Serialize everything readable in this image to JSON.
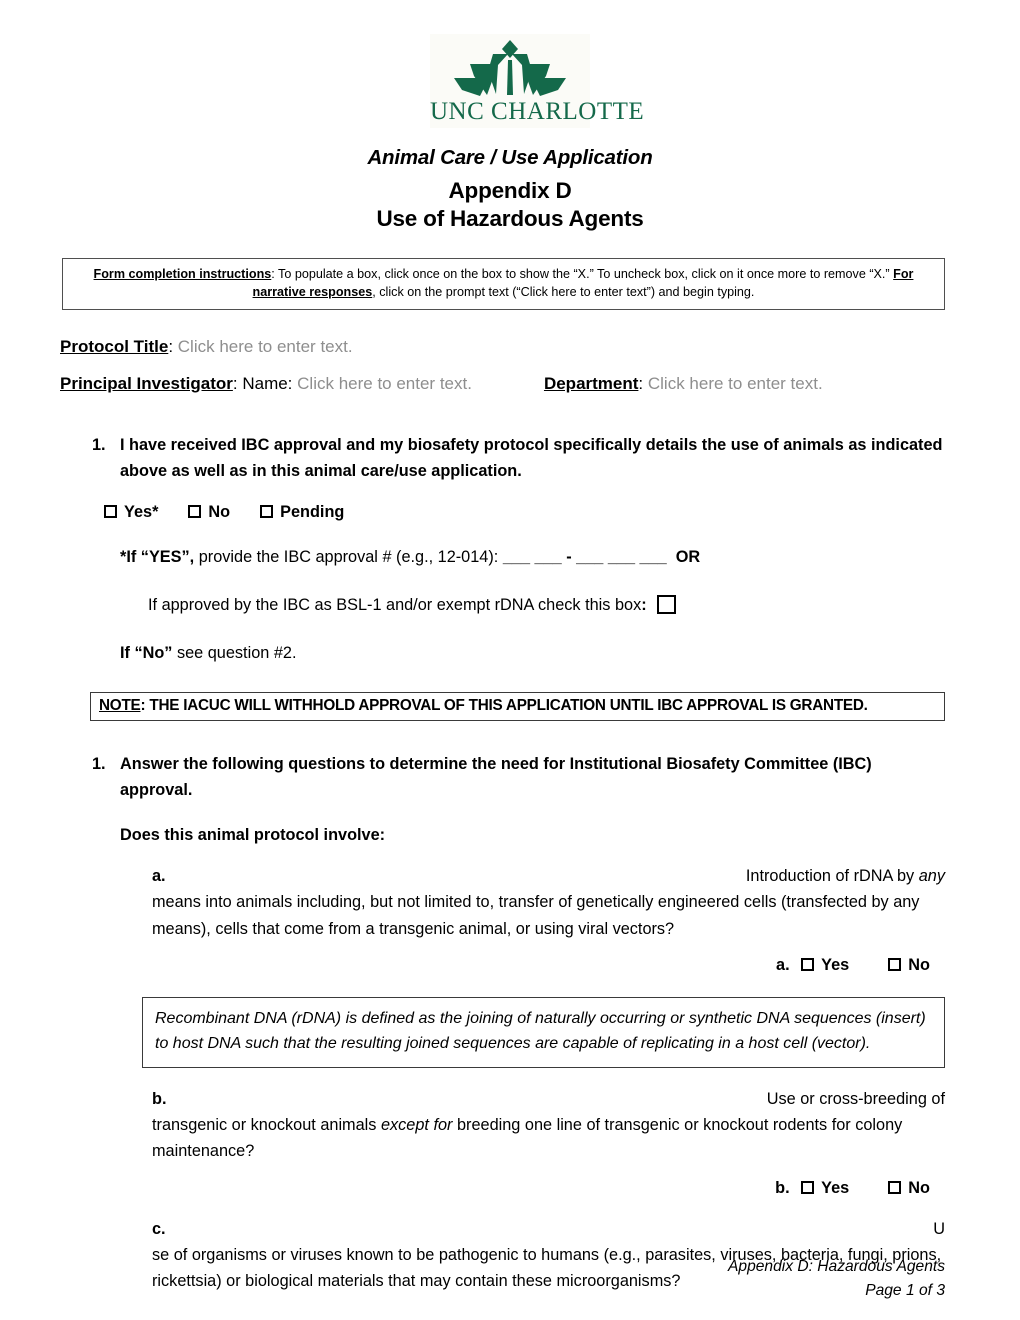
{
  "logo": {
    "institution": "UNC CHARLOTTE",
    "mark": "crown-icon",
    "brand_green": "#14694a"
  },
  "header": {
    "subtitle": "Animal Care / Use Application",
    "title_line1": "Appendix D",
    "title_line2": "Use of Hazardous Agents"
  },
  "instructions": {
    "label": "Form completion instructions",
    "text_part1": ": To populate a box, click once on the box to show the “X.”  To uncheck box, click on it once more to remove “X.” ",
    "label2": "For narrative responses",
    "text_part2": ", click on the prompt text (“Click here to enter text”) and begin typing."
  },
  "fields": {
    "protocol_title_label": "Protocol Title",
    "protocol_title_colon": ": ",
    "protocol_title_value": "Click here to enter text.",
    "pi_label": "Principal Investigator",
    "pi_name_prefix": ": Name: ",
    "pi_name_value": "Click here to enter text.",
    "department_label": "Department",
    "department_colon": ":  ",
    "department_value": "Click here to enter text."
  },
  "question1": {
    "number": "1.",
    "text": "I have received IBC approval and my biosafety protocol specifically details the use of animals as indicated above as well as in this animal care/use application.",
    "options": [
      {
        "label": "Yes*",
        "checked": false
      },
      {
        "label": "No",
        "checked": false
      },
      {
        "label": "Pending",
        "checked": false
      }
    ],
    "if_yes_bold": "*If “YES”,",
    "if_yes_rest": " provide the IBC approval # (e.g., 12-014): ",
    "blank_pattern": "___ ___ - ___ ___ ___",
    "or_label": "OR",
    "bsl_text": "If approved by the IBC as BSL-1 and/or exempt rDNA check this box",
    "bsl_colon": ":",
    "bsl_checked": false,
    "if_no_bold": "If “No”",
    "if_no_rest": " see question #2."
  },
  "note": {
    "label": "NOTE",
    "text": ": THE IACUC WILL WITHHOLD APPROVAL OF THIS APPLICATION UNTIL IBC APPROVAL IS GRANTED."
  },
  "question2": {
    "number": "1.",
    "text": "Answer the following questions to determine the need for Institutional Biosafety Committee (IBC) approval.",
    "prompt": "Does this animal protocol involve:",
    "items": [
      {
        "letter": "a.",
        "first_line_right": "Introduction of rDNA by ",
        "first_line_right_italic": "any",
        "rest": "means into animals including, but not limited to, transfer of genetically engineered cells (transfected by any means), cells that come from a transgenic animal, or using viral vectors?",
        "answer_letter": "a.",
        "yes_label": "Yes",
        "no_label": "No",
        "yes_checked": false,
        "no_checked": false
      },
      {
        "letter": "b.",
        "first_line_right": "Use or cross-breeding of",
        "rest_part1": "transgenic or knockout animals ",
        "rest_italic": "except for",
        "rest_part2": " breeding one line of transgenic or knockout rodents for colony maintenance?",
        "answer_letter": "b.",
        "yes_label": "Yes",
        "no_label": "No",
        "yes_checked": false,
        "no_checked": false
      },
      {
        "letter": "c.",
        "first_line_right": "U",
        "rest": "se of organisms or viruses known to be pathogenic to humans (e.g., parasites, viruses, bacteria, fungi, prions, rickettsia) or biological materials that may contain these microorganisms?"
      }
    ]
  },
  "definition_box": {
    "text": "Recombinant DNA (rDNA) is defined as the joining of naturally occurring or synthetic DNA sequences (insert) to host DNA such that the resulting joined sequences are capable of replicating in a host cell (vector)."
  },
  "footer": {
    "line1": "Appendix D:  Hazardous Agents",
    "line2_prefix": "Page ",
    "page_number": "1",
    "line2_mid": " of ",
    "page_total": "3"
  }
}
